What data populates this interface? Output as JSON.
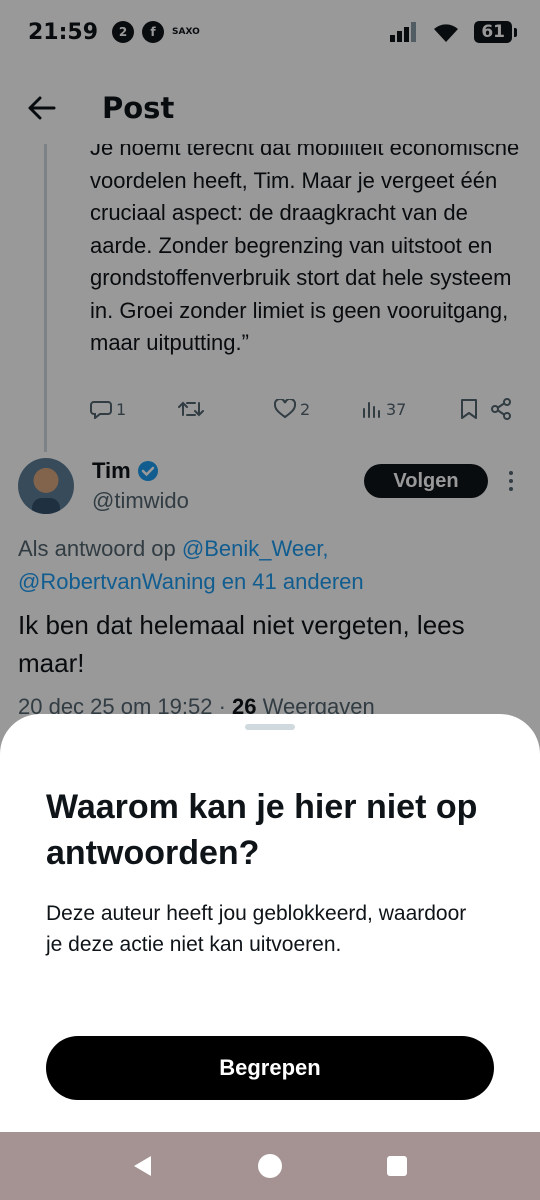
{
  "status_bar": {
    "time": "21:59",
    "app_icons": [
      "app-notification-icon",
      "facebook-icon"
    ],
    "saxo_label": "SAXO",
    "battery": "61"
  },
  "header": {
    "title": "Post"
  },
  "quoted_post": {
    "text": "Je noemt terecht dat mobiliteit economische voordelen heeft, Tim. Maar je vergeet één cruciaal aspect: de draagkracht van de aarde. Zonder begrenzing van uitstoot en grondstoffenverbruik stort dat hele systeem in. Groei zonder limiet is geen vooruitgang, maar uitputting.”",
    "replies": "1",
    "reposts": "",
    "likes": "2",
    "views": "37"
  },
  "reply": {
    "author_name": "Tim",
    "author_handle": "@timwido",
    "follow_label": "Volgen",
    "reply_to_prefix": "Als antwoord op ",
    "reply_to_mentions": "@Benik_Weer, @RobertvanWaning en 41 anderen",
    "text": "Ik ben dat helemaal niet vergeten, lees maar!",
    "timestamp": "20 dec 25 om 19:52 · ",
    "view_count": "26",
    "view_label": " Weergaven"
  },
  "sheet": {
    "title": "Waarom kan je hier niet op antwoorden?",
    "body": "Deze auteur heeft jou geblokkeerd, waardoor je deze actie niet kan uitvoeren.",
    "button_label": "Begrepen"
  },
  "colors": {
    "accent": "#1d9bf0",
    "text": "#0f1419",
    "muted": "#536471",
    "nav_bar": "#a59393"
  }
}
